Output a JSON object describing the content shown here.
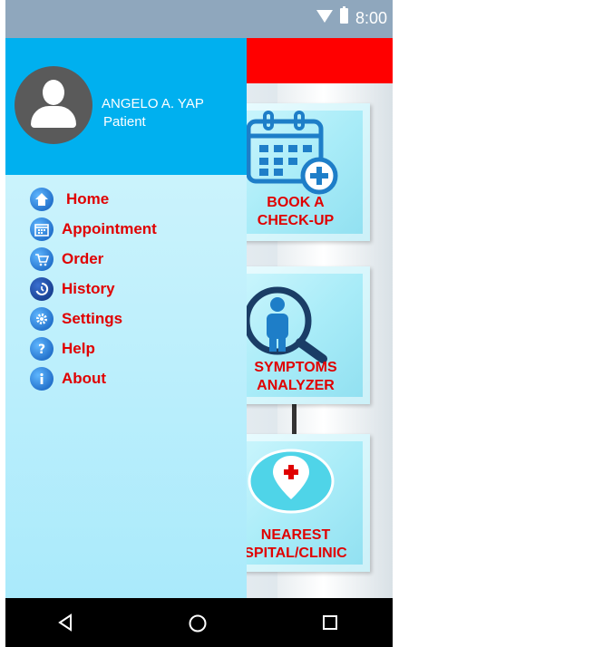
{
  "status_bar": {
    "time": "8:00"
  },
  "drawer": {
    "user_name": "ANGELO A. YAP",
    "user_role": "Patient",
    "items": [
      {
        "label": "Home",
        "icon": "home-icon"
      },
      {
        "label": "Appointment",
        "icon": "calendar-icon"
      },
      {
        "label": "Order",
        "icon": "cart-icon"
      },
      {
        "label": "History",
        "icon": "history-icon"
      },
      {
        "label": "Settings",
        "icon": "gear-icon"
      },
      {
        "label": "Help",
        "icon": "help-icon"
      },
      {
        "label": "About",
        "icon": "info-icon"
      }
    ]
  },
  "cards": {
    "book": "BOOK A\nCHECK-UP",
    "symptoms": "SYMPTOMS\nANALYZER",
    "nearest": "NEAREST\nSPITAL/CLINIC"
  },
  "colors": {
    "app_bar": "#ff0000",
    "drawer_header": "#00b0ef",
    "label_red": "#e00000"
  }
}
